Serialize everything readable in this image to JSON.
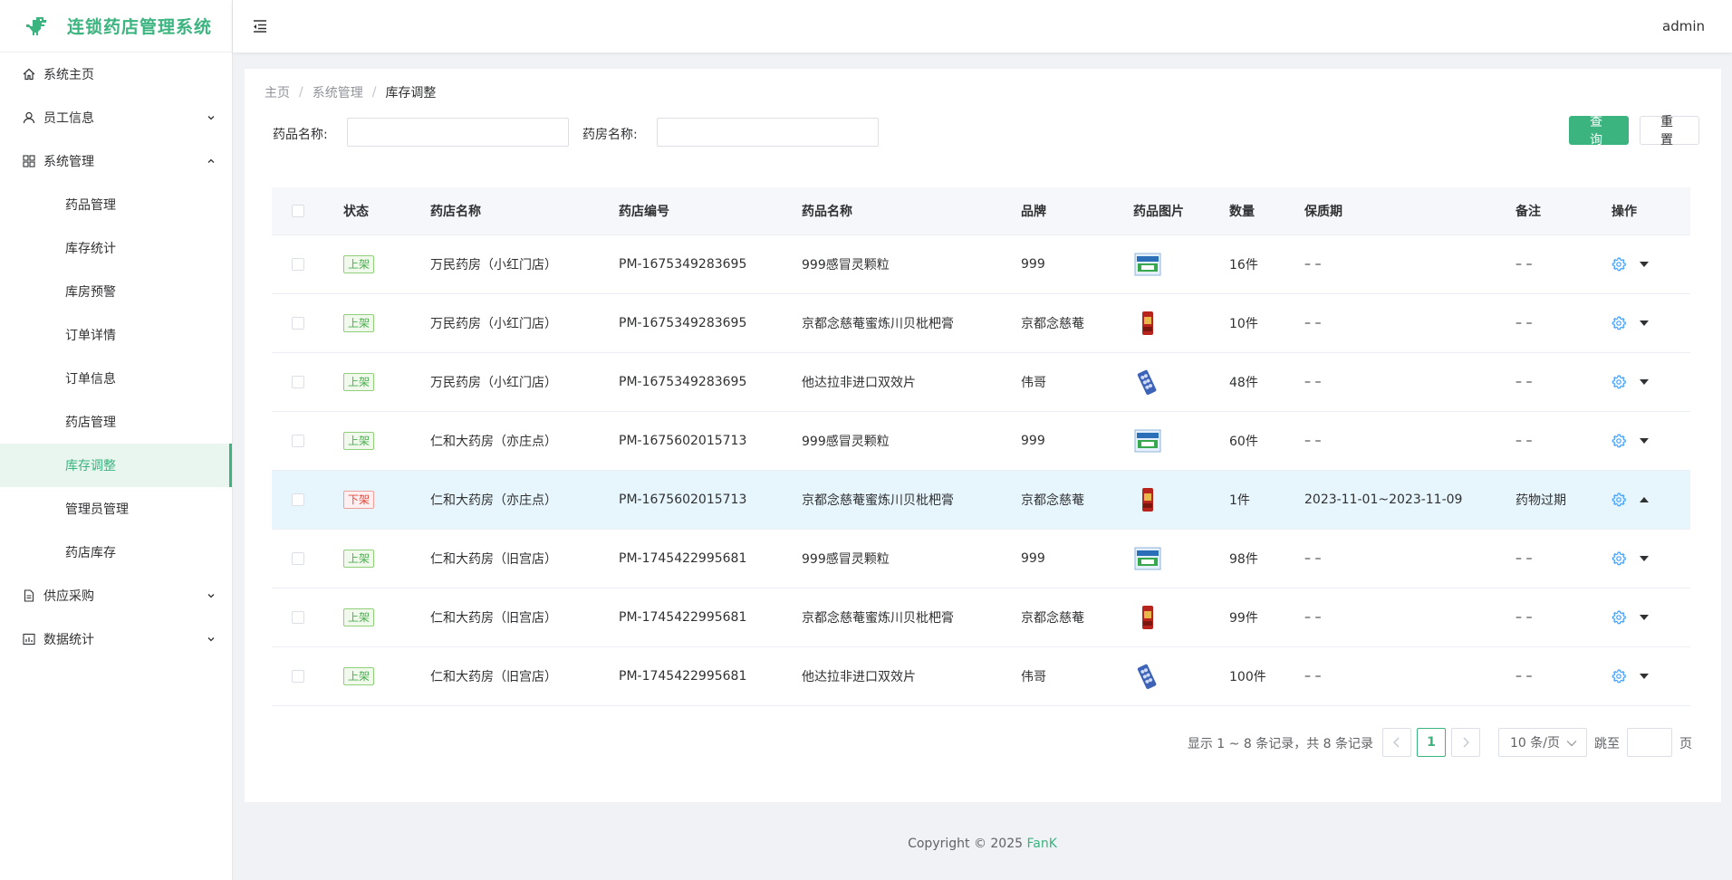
{
  "app": {
    "title": "连锁药店管理系统",
    "user": "admin"
  },
  "sidebar": {
    "items": [
      {
        "label": "系统主页",
        "icon": "home-icon"
      },
      {
        "label": "员工信息",
        "icon": "user-icon"
      },
      {
        "label": "系统管理",
        "icon": "grid-icon"
      },
      {
        "label": "供应采购",
        "icon": "document-icon"
      },
      {
        "label": "数据统计",
        "icon": "chart-icon"
      }
    ],
    "subitems": [
      {
        "label": "药品管理"
      },
      {
        "label": "库存统计"
      },
      {
        "label": "库房预警"
      },
      {
        "label": "订单详情"
      },
      {
        "label": "订单信息"
      },
      {
        "label": "药店管理"
      },
      {
        "label": "库存调整"
      },
      {
        "label": "管理员管理"
      },
      {
        "label": "药店库存"
      }
    ]
  },
  "breadcrumb": {
    "home": "主页",
    "section": "系统管理",
    "current": "库存调整",
    "separator": "/"
  },
  "filters": {
    "drug_label": "药品名称:",
    "drug_value": "",
    "store_label": "药房名称:",
    "store_value": "",
    "query": "查询",
    "reset": "重置"
  },
  "table": {
    "columns": [
      "状态",
      "药店名称",
      "药店编号",
      "药品名称",
      "品牌",
      "药品图片",
      "数量",
      "保质期",
      "备注",
      "操作"
    ],
    "rows": [
      {
        "status": "上架",
        "store": "万民药房（小红门店）",
        "code": "PM-1675349283695",
        "drug": "999感冒灵颗粒",
        "brand": "999",
        "qty": "16件",
        "expiry": "– –",
        "note": "– –",
        "image": "box-green"
      },
      {
        "status": "上架",
        "store": "万民药房（小红门店）",
        "code": "PM-1675349283695",
        "drug": "京都念慈菴蜜炼川贝枇杷膏",
        "brand": "京都念慈菴",
        "qty": "10件",
        "expiry": "– –",
        "note": "– –",
        "image": "bottle-red"
      },
      {
        "status": "上架",
        "store": "万民药房（小红门店）",
        "code": "PM-1675349283695",
        "drug": "他达拉非进口双效片",
        "brand": "伟哥",
        "qty": "48件",
        "expiry": "– –",
        "note": "– –",
        "image": "blister-blue"
      },
      {
        "status": "上架",
        "store": "仁和大药房（亦庄点）",
        "code": "PM-1675602015713",
        "drug": "999感冒灵颗粒",
        "brand": "999",
        "qty": "60件",
        "expiry": "– –",
        "note": "– –",
        "image": "box-green"
      },
      {
        "status": "下架",
        "store": "仁和大药房（亦庄点）",
        "code": "PM-1675602015713",
        "drug": "京都念慈菴蜜炼川贝枇杷膏",
        "brand": "京都念慈菴",
        "qty": "1件",
        "expiry": "2023-11-01~2023-11-09",
        "note": "药物过期",
        "image": "bottle-red",
        "highlight": true
      },
      {
        "status": "上架",
        "store": "仁和大药房（旧宫店）",
        "code": "PM-1745422995681",
        "drug": "999感冒灵颗粒",
        "brand": "999",
        "qty": "98件",
        "expiry": "– –",
        "note": "– –",
        "image": "box-green"
      },
      {
        "status": "上架",
        "store": "仁和大药房（旧宫店）",
        "code": "PM-1745422995681",
        "drug": "京都念慈菴蜜炼川贝枇杷膏",
        "brand": "京都念慈菴",
        "qty": "99件",
        "expiry": "– –",
        "note": "– –",
        "image": "bottle-red"
      },
      {
        "status": "上架",
        "store": "仁和大药房（旧宫店）",
        "code": "PM-1745422995681",
        "drug": "他达拉非进口双效片",
        "brand": "伟哥",
        "qty": "100件",
        "expiry": "– –",
        "note": "– –",
        "image": "blister-blue"
      }
    ]
  },
  "pagination": {
    "summary": "显示 1 ~ 8 条记录，共 8 条记录",
    "current_page": "1",
    "page_size": "10 条/页",
    "jump_label": "跳至",
    "page_suffix": "页"
  },
  "footer": {
    "prefix": "Copyright © 2025 ",
    "brand": "FanK"
  },
  "colors": {
    "accent": "#3bb47f",
    "highlight_row": "#e6f6fc",
    "tag_on": "#4caf50",
    "tag_off": "#e5483c",
    "gear": "#409eff"
  }
}
